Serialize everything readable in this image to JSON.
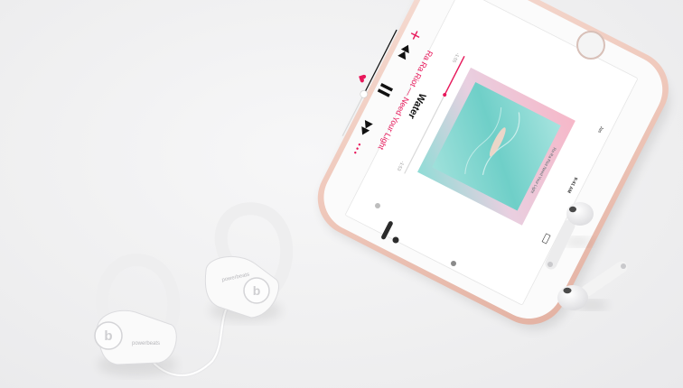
{
  "player": {
    "song_title": "Water",
    "artist_album": "Ra Ra Riot — Need Your Light",
    "elapsed": "-1:55",
    "remaining": "-1:53",
    "album_art_text": "Ra Ra Riot   Need Your Light"
  },
  "phone": {
    "carrier": "Jas",
    "time": "9:41 AM"
  },
  "earphones": {
    "brand_text": "powerbeats",
    "logo_letter": "b"
  },
  "colors": {
    "accent": "#e8185b",
    "rose_gold": "#f0c9bd",
    "album_teal": "#7fd8d1",
    "album_pink": "#f3b3c3"
  }
}
